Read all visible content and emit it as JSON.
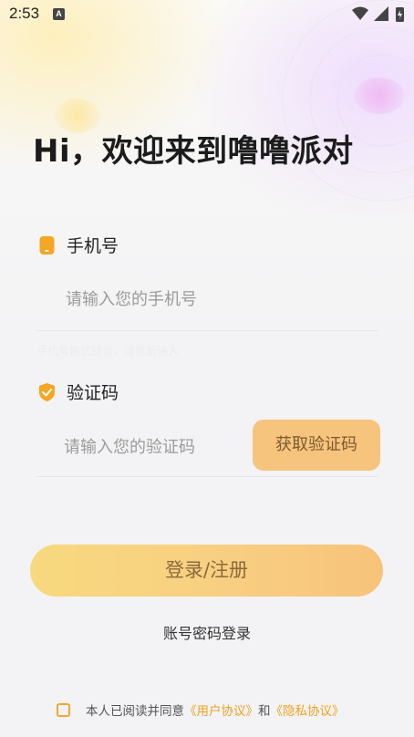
{
  "status_bar": {
    "time": "2:53",
    "notification_icon": "A"
  },
  "headline": "Hi，欢迎来到噜噜派对",
  "phone": {
    "label": "手机号",
    "placeholder": "请输入您的手机号",
    "value": ""
  },
  "code": {
    "label": "验证码",
    "placeholder": "请输入您的验证码",
    "value": "",
    "get_code_button": "获取验证码"
  },
  "faint_hint": "手机号格式错误，请重新输入",
  "login_button": "登录/注册",
  "password_login_link": "账号密码登录",
  "agreement": {
    "prefix": "本人已阅读并同意",
    "user_agreement": "《用户协议》",
    "and": "和",
    "privacy_policy": "《隐私协议》",
    "checked": false
  },
  "colors": {
    "accent": "#f7c47e",
    "link": "#f0a01e",
    "icon": "#f5a623"
  }
}
